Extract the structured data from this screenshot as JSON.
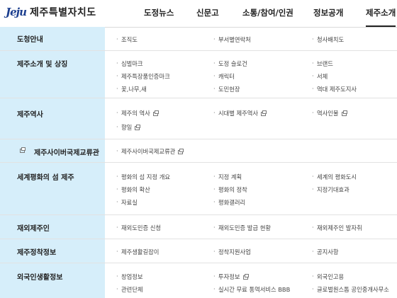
{
  "header": {
    "logo_mark": "Jeju",
    "logo_text": "제주특별자치도",
    "nav": [
      "도정뉴스",
      "신문고",
      "소통/참여/인권",
      "정보공개",
      "제주소개"
    ]
  },
  "sections": [
    {
      "title": "도청안내",
      "items": [
        "조직도",
        "부서별연락처",
        "청사배치도"
      ]
    },
    {
      "title": "제주소개 및 상징",
      "items": [
        "심벌마크",
        "도정 슬로건",
        "브랜드",
        "제주특장품인증마크",
        "캐릭터",
        "서체",
        "꽃,나무,새",
        "도민헌장",
        "역대 제주도지사"
      ]
    },
    {
      "title": "제주역사",
      "items": [
        "제주의 역사",
        "시대별 제주역사",
        "역사인물",
        "향일"
      ]
    },
    {
      "title": "제주사이버국제교류관",
      "items": [
        "제주사이버국제교류관"
      ]
    },
    {
      "title": "세계평화의 섬 제주",
      "items": [
        "평화의 섬 지정 개요",
        "지정 계획",
        "세계의 평화도시",
        "평화의 확산",
        "평화의 정착",
        "지정기대효과",
        "자료실",
        "평화갤러리"
      ]
    },
    {
      "title": "재외제주인",
      "items": [
        "재외도민증 신청",
        "재외도민증 발급 현황",
        "재외제주인 발자취"
      ]
    },
    {
      "title": "제주정착정보",
      "items": [
        "제주생활길잡이",
        "정착지원사업",
        "공지사항"
      ]
    },
    {
      "title": "외국인생활정보",
      "items": [
        "창업정보",
        "투자정보",
        "외국인고용",
        "관련단체",
        "실시간 무료 통역서비스 BBB",
        "글로벌원스톱 공인중개사무소"
      ]
    }
  ]
}
